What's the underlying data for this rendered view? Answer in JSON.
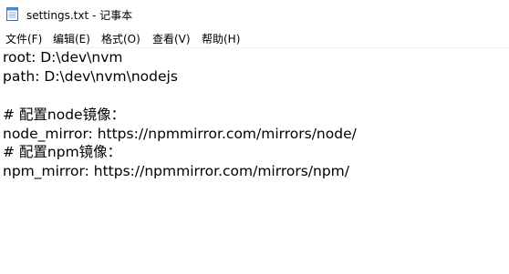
{
  "window": {
    "title": "settings.txt - 记事本",
    "icon": "notepad-icon"
  },
  "menu": {
    "file": "文件(F)",
    "edit": "编辑(E)",
    "format": "格式(O)",
    "view": "查看(V)",
    "help": "帮助(H)"
  },
  "editor": {
    "lines": [
      "root: D:\\dev\\nvm",
      "path: D:\\dev\\nvm\\nodejs",
      "",
      "# 配置node镜像：",
      "node_mirror: https://npmmirror.com/mirrors/node/",
      "# 配置npm镜像：",
      "npm_mirror: https://npmmirror.com/mirrors/npm/"
    ]
  }
}
